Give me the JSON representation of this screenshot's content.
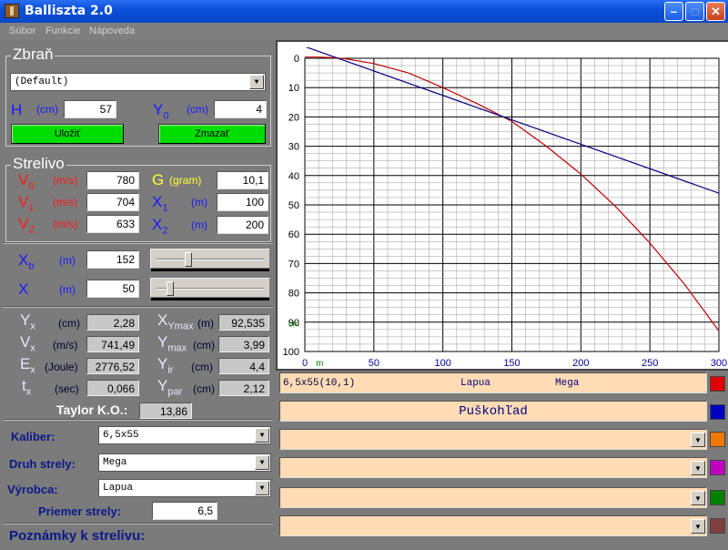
{
  "window": {
    "title": "Balliszta 2.0"
  },
  "menu": [
    "Súbor",
    "Funkcie",
    "Nápoveda"
  ],
  "zbran": {
    "title": "Zbraň",
    "weapon": "(Default)",
    "h_label": "H",
    "h_unit": "(cm)",
    "h_value": "57",
    "y0_label": "Y",
    "y0_sub": "0",
    "y0_unit": "(cm)",
    "y0_value": "4",
    "save": "Uložiť",
    "delete": "Zmazať"
  },
  "strelivo": {
    "title": "Strelivo",
    "v0": {
      "label": "V",
      "sub": "0",
      "unit": "(m/s)",
      "value": "780"
    },
    "v1": {
      "label": "V",
      "sub": "1",
      "unit": "(m/s)",
      "value": "704"
    },
    "v2": {
      "label": "V",
      "sub": "2",
      "unit": "(m/s)",
      "value": "633"
    },
    "g": {
      "label": "G",
      "unit": "(gram)",
      "value": "10,1"
    },
    "x1": {
      "label": "X",
      "sub": "1",
      "unit": "(m)",
      "value": "100"
    },
    "x2": {
      "label": "X",
      "sub": "2",
      "unit": "(m)",
      "value": "200"
    }
  },
  "sliders": {
    "xb": {
      "label": "X",
      "sub": "b",
      "unit": "(m)",
      "value": "152",
      "level": 0.28
    },
    "x": {
      "label": "X",
      "unit": "(m)",
      "value": "50",
      "level": 0.1
    }
  },
  "results": {
    "yx": {
      "label": "Y",
      "sub": "x",
      "unit": "(cm)",
      "value": "2,28"
    },
    "vx": {
      "label": "V",
      "sub": "x",
      "unit": "(m/s)",
      "value": "741,49"
    },
    "ex": {
      "label": "E",
      "sub": "x",
      "unit": "(Joule)",
      "value": "2776,52"
    },
    "tx": {
      "label": "t",
      "sub": "x",
      "unit": "(sec)",
      "value": "0,066"
    },
    "xymax": {
      "label": "X",
      "sub": "Ymax",
      "unit": "(m)",
      "value": "92,535"
    },
    "ymax": {
      "label": "Y",
      "sub": "max",
      "unit": "(cm)",
      "value": "3,99"
    },
    "yir": {
      "label": "Y",
      "sub": "ir",
      "unit": "(cm)",
      "value": "4,4"
    },
    "ypar": {
      "label": "Y",
      "sub": "par",
      "unit": "(cm)",
      "value": "2,12"
    },
    "taylor": {
      "label": "Taylor K.O.:",
      "value": "13,86"
    }
  },
  "ammo_form": {
    "caliber_label": "Kaliber:",
    "caliber": "6,5x55",
    "type_label": "Druh strely:",
    "type": "Mega",
    "maker_label": "Výrobca:",
    "maker": "Lapua",
    "diameter_label": "Priemer strely:",
    "diameter": "6,5",
    "notes_label": "Poznámky k strelivu:"
  },
  "list": {
    "row1": {
      "name": "6,5x55(10,1)",
      "maker": "Lapua",
      "type": "Mega"
    },
    "row2": {
      "text": "Puškohľad"
    }
  },
  "colors": {
    "red": "#e00000",
    "blue": "#0000c0",
    "orange": "#f07800",
    "magenta": "#c000c0",
    "green": "#008000",
    "brown": "#804040"
  },
  "chart_data": {
    "type": "line",
    "xlim": [
      0,
      300
    ],
    "ylim": [
      0,
      100
    ],
    "y_inverted": true,
    "x_ticks": [
      0,
      50,
      100,
      150,
      200,
      250,
      300
    ],
    "y_ticks": [
      0,
      10,
      20,
      30,
      40,
      50,
      60,
      70,
      80,
      90,
      100
    ],
    "xlabel": "m",
    "ylabel": "cm",
    "grid": true,
    "series": [
      {
        "color": "#c00000",
        "x": [
          0,
          10,
          20,
          30,
          50,
          75,
          100,
          125,
          150,
          175,
          200,
          225,
          250,
          275,
          300
        ],
        "y": [
          -0.4,
          -0.4,
          -0.2,
          0.2,
          1.8,
          5,
          10,
          15.5,
          21.5,
          30,
          39.5,
          50.5,
          63,
          77,
          93
        ]
      },
      {
        "color": "#000080",
        "x": [
          0,
          300
        ],
        "y": [
          -4,
          46
        ]
      }
    ]
  }
}
